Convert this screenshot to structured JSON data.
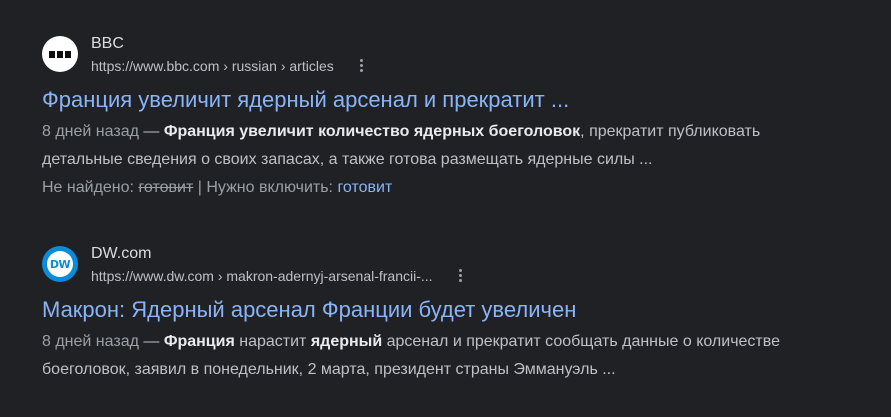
{
  "results": [
    {
      "site_name": "BBC",
      "url": "https://www.bbc.com › russian › articles",
      "title": "Франция увеличит ядерный арсенал и прекратит ...",
      "date": "8 дней назад",
      "dash": " — ",
      "snippet_parts": [
        {
          "text": "Франция увеличит количество ядерных боеголовок",
          "bold": true
        },
        {
          "text": ", прекратит публиковать",
          "bold": false
        },
        {
          "text": "детальные сведения о своих запасах, а также готова размещать ядерные силы ...",
          "bold": false
        }
      ],
      "missing_label": "Не найдено: ",
      "missing_term": "готовит",
      "must_include_label": " | Нужно включить: ",
      "must_include_term": "готовит",
      "favicon_icon": "bbc-logo-icon"
    },
    {
      "site_name": "DW.com",
      "url": "https://www.dw.com › makron-adernyj-arsenal-francii-...",
      "title": "Макрон: Ядерный арсенал Франции будет увеличен",
      "date": "8 дней назад",
      "dash": " — ",
      "snippet_parts": [
        {
          "text": "Франция",
          "bold": true
        },
        {
          "text": " нарастит ",
          "bold": false
        },
        {
          "text": "ядерный",
          "bold": true
        },
        {
          "text": " арсенал и прекратит сообщать данные о количестве",
          "bold": false
        },
        {
          "text": "боеголовок, заявил в понедельник, 2 марта, президент страны Эммануэль ...",
          "bold": false
        }
      ],
      "favicon_text": "DW",
      "favicon_icon": "dw-logo-icon"
    }
  ],
  "colors": {
    "background": "#202124",
    "link": "#8ab4f8",
    "text": "#bdc1c6",
    "bold_text": "#e8eaed"
  }
}
